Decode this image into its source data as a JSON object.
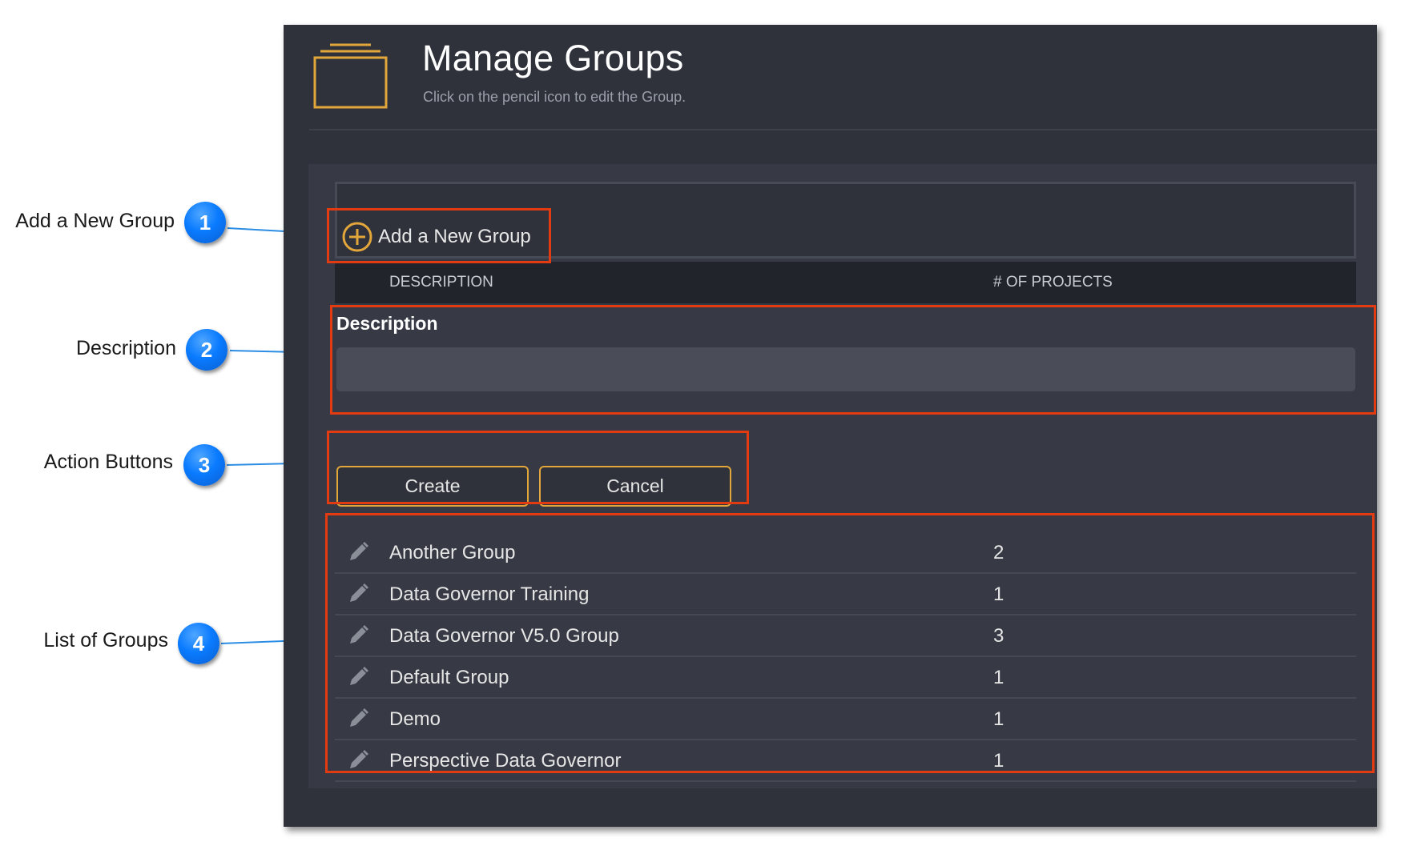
{
  "header": {
    "title": "Manage Groups",
    "subtitle": "Click on the pencil icon to edit the Group."
  },
  "toolbar": {
    "add_group_label": "Add a New Group"
  },
  "table": {
    "columns": [
      "DESCRIPTION",
      "# OF PROJECTS"
    ]
  },
  "form": {
    "description_label": "Description",
    "description_value": "",
    "create_label": "Create",
    "cancel_label": "Cancel"
  },
  "groups": [
    {
      "name": "Another Group",
      "projects": "2"
    },
    {
      "name": "Data Governor Training",
      "projects": "1"
    },
    {
      "name": "Data Governor V5.0 Group",
      "projects": "3"
    },
    {
      "name": "Default Group",
      "projects": "1"
    },
    {
      "name": "Demo",
      "projects": "1"
    },
    {
      "name": "Perspective Data Governor",
      "projects": "1"
    }
  ],
  "callouts": [
    {
      "number": "1",
      "label": "Add a New Group"
    },
    {
      "number": "2",
      "label": "Description"
    },
    {
      "number": "3",
      "label": "Action Buttons"
    },
    {
      "number": "4",
      "label": "List of Groups"
    }
  ],
  "colors": {
    "panel_bg": "#2f323b",
    "accent_orange": "#e2a63b",
    "callout_red": "#e23b12",
    "callout_blue": "#0a7bff"
  },
  "icons": {
    "header": "folder-icon",
    "add": "plus-circle-icon",
    "edit": "pencil-icon"
  }
}
